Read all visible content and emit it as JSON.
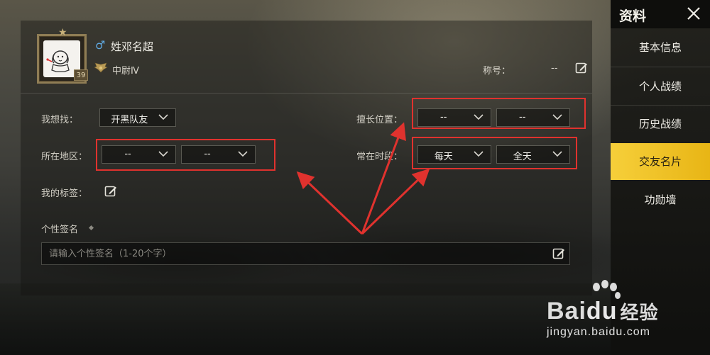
{
  "profile": {
    "player_name": "姓邓名超",
    "rank": "中尉Ⅳ",
    "level_badge": "39",
    "title_label": "称号：",
    "title_value": "--"
  },
  "form": {
    "looking_for_label": "我想找：",
    "looking_for_value": "开黑队友",
    "region_label": "所在地区：",
    "region_province": "--",
    "region_city": "--",
    "position_label": "擅长位置：",
    "position_primary": "--",
    "position_secondary": "--",
    "time_label": "常在时段：",
    "time_days": "每天",
    "time_hours": "全天",
    "tags_label": "我的标签：",
    "signature_label": "个性签名",
    "signature_placeholder": "请输入个性签名（1-20个字）"
  },
  "sidebar": {
    "title": "资料",
    "items": [
      {
        "label": "基本信息",
        "active": false
      },
      {
        "label": "个人战绩",
        "active": false
      },
      {
        "label": "历史战绩",
        "active": false
      },
      {
        "label": "交友名片",
        "active": true
      },
      {
        "label": "功勋墙",
        "active": false
      }
    ]
  },
  "watermark": {
    "logo_latin_1": "Bai",
    "logo_latin_2": "du",
    "logo_cn": "经验",
    "url": "jingyan.baidu.com"
  },
  "colors": {
    "accent_active": "#f0c22a",
    "annotation_red": "#e0322e",
    "gender_icon": "#5fa8e0"
  }
}
